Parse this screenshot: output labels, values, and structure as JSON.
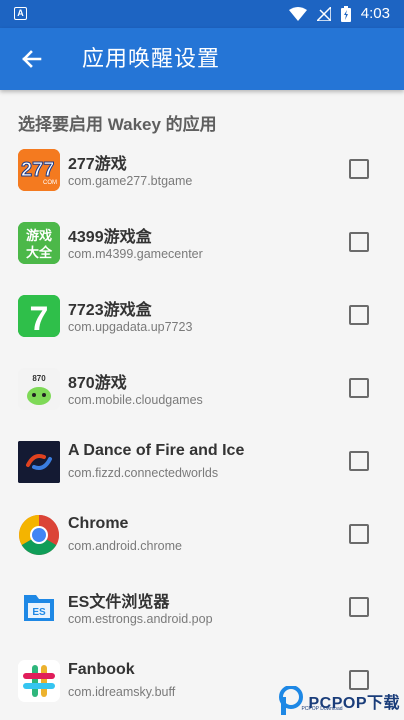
{
  "status_bar": {
    "left_icon": "A",
    "time": "4:03",
    "icons": [
      "wifi-icon",
      "signal-icon",
      "battery-icon"
    ]
  },
  "app_bar": {
    "title": "应用唤醒设置",
    "back_icon": "arrow-left-icon"
  },
  "section": {
    "header": "选择要启用 Wakey 的应用"
  },
  "apps": [
    {
      "name": "277游戏",
      "package": "com.game277.btgame",
      "checked": false
    },
    {
      "name": "4399游戏盒",
      "package": "com.m4399.gamecenter",
      "checked": false
    },
    {
      "name": "7723游戏盒",
      "package": "com.upgadata.up7723",
      "checked": false
    },
    {
      "name": "870游戏",
      "package": "com.mobile.cloudgames",
      "checked": false
    },
    {
      "name": "A Dance of Fire and Ice",
      "package": "com.fizzd.connectedworlds",
      "checked": false
    },
    {
      "name": "Chrome",
      "package": "com.android.chrome",
      "checked": false
    },
    {
      "name": "ES文件浏览器",
      "package": "com.estrongs.android.pop",
      "checked": false
    },
    {
      "name": "Fanbook",
      "package": "com.idreamsky.buff",
      "checked": false
    }
  ],
  "icon_labels": {
    "icon_277": "277",
    "icon_277_sub": "COM",
    "icon_4399_top": "游戏",
    "icon_4399_bottom": "大全",
    "icon_7723": "7",
    "icon_870": "870",
    "icon_es": "ES"
  },
  "watermark": {
    "brand": "PCPOP下载",
    "sub": "PCPOP Download"
  },
  "colors": {
    "status_bar": "#1d64c2",
    "app_bar": "#2575d6",
    "background": "#f5f5f5"
  }
}
